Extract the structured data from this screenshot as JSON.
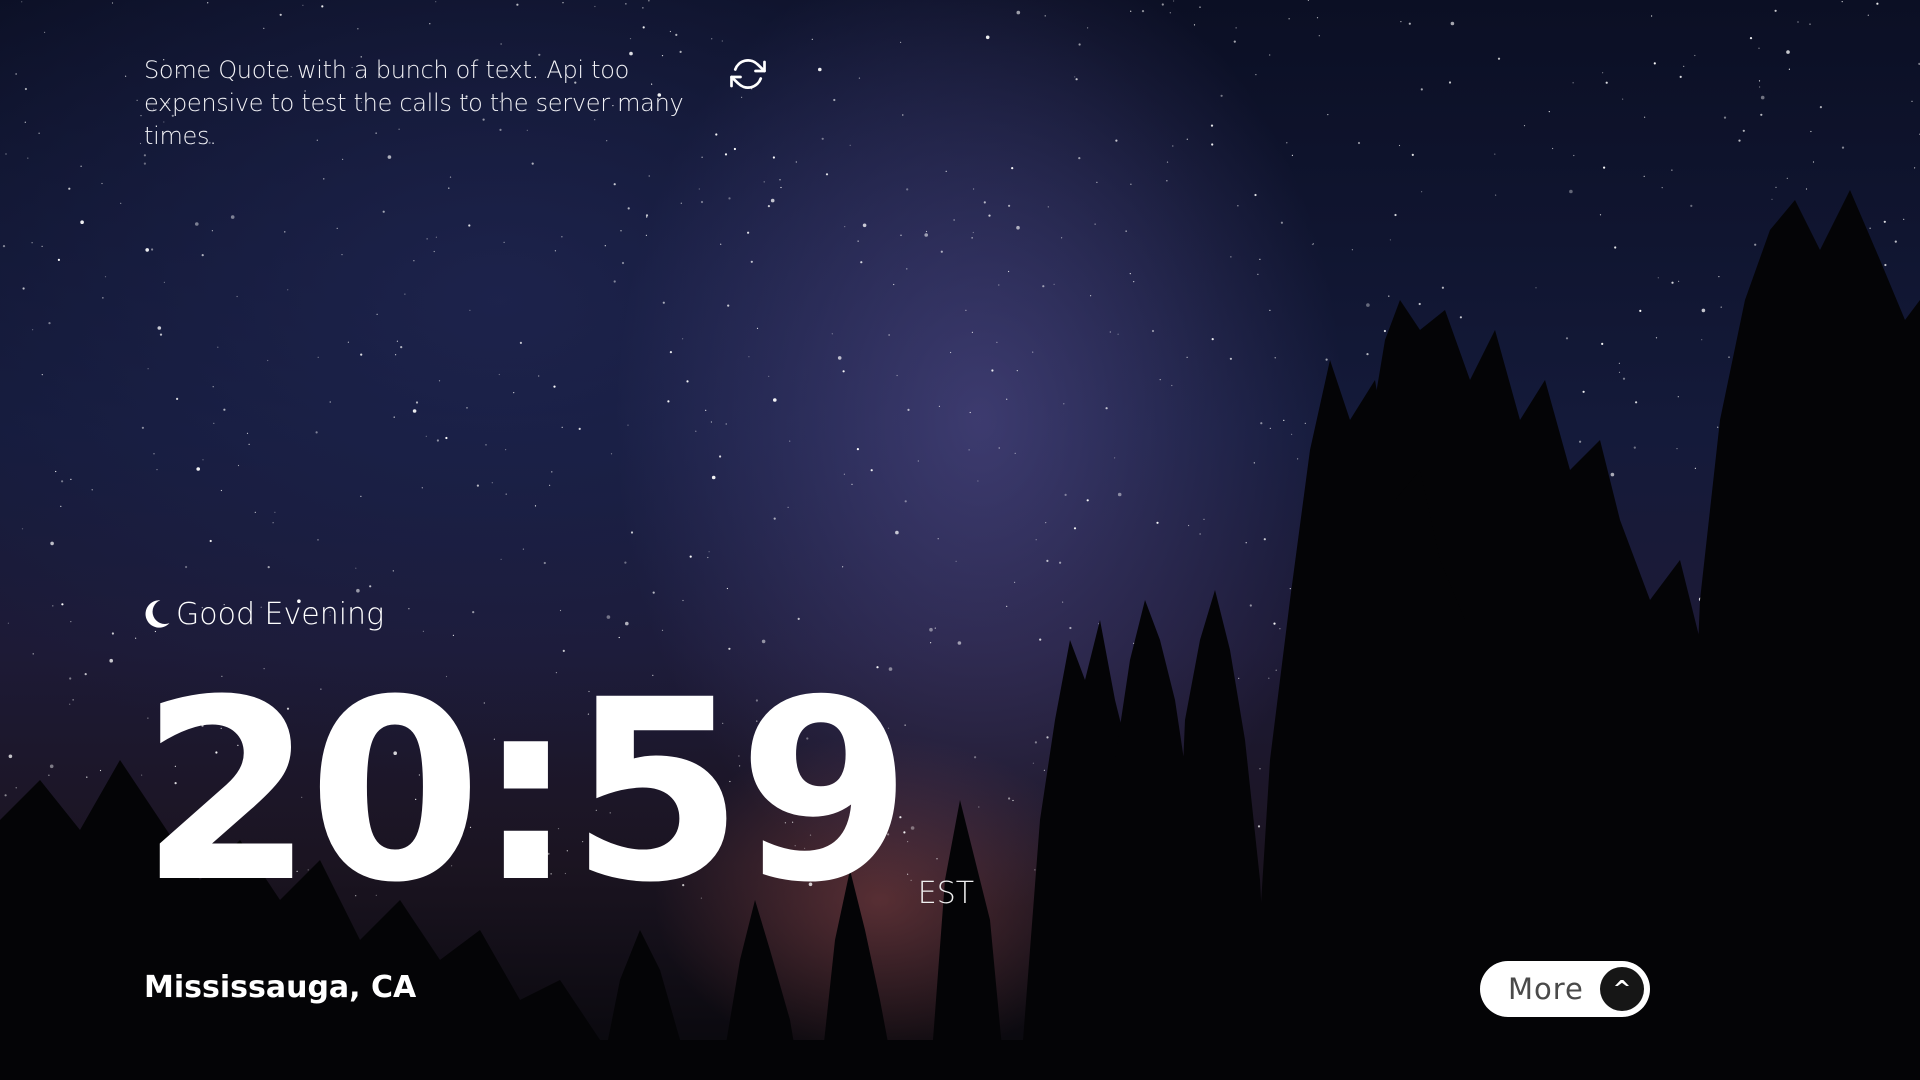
{
  "quote": {
    "text": "Some Quote with a bunch of text. Api too expensive to test the calls to the server many times."
  },
  "icons": {
    "refresh": "refresh-icon",
    "moon": "moon-icon",
    "chevron": "chevron-up-icon"
  },
  "greeting": {
    "text": "Good Evening"
  },
  "clock": {
    "time": "20:59",
    "timezone": "EST"
  },
  "location": {
    "text": "Mississauga, CA"
  },
  "more_button": {
    "label": "More",
    "arrow": "^"
  },
  "colors": {
    "sky_top": "#0b0f24",
    "sky_mid": "#1d1a36",
    "horizon_glow": "#8c4646",
    "text": "#ffffff",
    "button_bg": "#ffffff",
    "button_text": "#4a4a4a",
    "button_arrow_bg": "#161616"
  }
}
